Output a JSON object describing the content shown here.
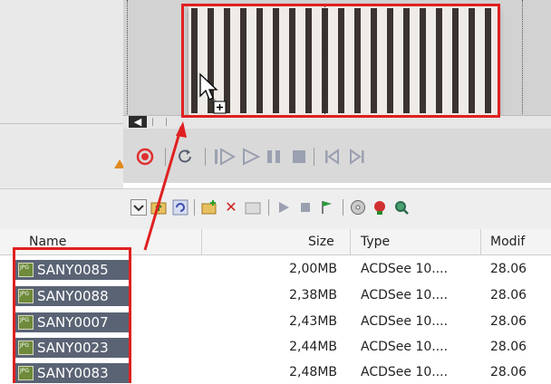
{
  "timeline": {
    "scroll_left_glyph": "◀"
  },
  "playback": {
    "buttons": [
      {
        "name": "record-icon"
      },
      {
        "name": "loop-icon"
      },
      {
        "name": "play-selection-icon"
      },
      {
        "name": "play-icon"
      },
      {
        "name": "pause-icon"
      },
      {
        "name": "stop-icon"
      },
      {
        "name": "skip-start-icon"
      },
      {
        "name": "skip-end-icon"
      }
    ]
  },
  "file_toolbar": {
    "icons": [
      "dropdown-icon",
      "folder-up-icon",
      "refresh-icon",
      "new-folder-icon",
      "delete-icon",
      "folder-icon",
      "play-icon",
      "stop-icon",
      "flag-icon",
      "disc-icon",
      "burn-icon",
      "search-icon"
    ]
  },
  "file_list": {
    "columns": [
      "Name",
      "Size",
      "Type",
      "Modif"
    ],
    "rows": [
      {
        "icon": "jpg-file-icon",
        "badge": "JPG",
        "name": "SANY0085",
        "size": "2,00MB",
        "type": "ACDSee 10....",
        "modified": "28.06"
      },
      {
        "icon": "jpg-file-icon",
        "badge": "JPG",
        "name": "SANY0088",
        "size": "2,38MB",
        "type": "ACDSee 10....",
        "modified": "28.06"
      },
      {
        "icon": "jpg-file-icon",
        "badge": "JPG",
        "name": "SANY0007",
        "size": "2,43MB",
        "type": "ACDSee 10....",
        "modified": "28.06"
      },
      {
        "icon": "jpg-file-icon",
        "badge": "JPG",
        "name": "SANY0023",
        "size": "2,44MB",
        "type": "ACDSee 10....",
        "modified": "28.06"
      },
      {
        "icon": "jpg-file-icon",
        "badge": "JPG",
        "name": "SANY0083",
        "size": "2,48MB",
        "type": "ACDSee 10....",
        "modified": "28.06"
      }
    ]
  },
  "colors": {
    "annotation_red": "#e02020",
    "selection_bg": "#5a6374",
    "record_red": "#e03030"
  }
}
